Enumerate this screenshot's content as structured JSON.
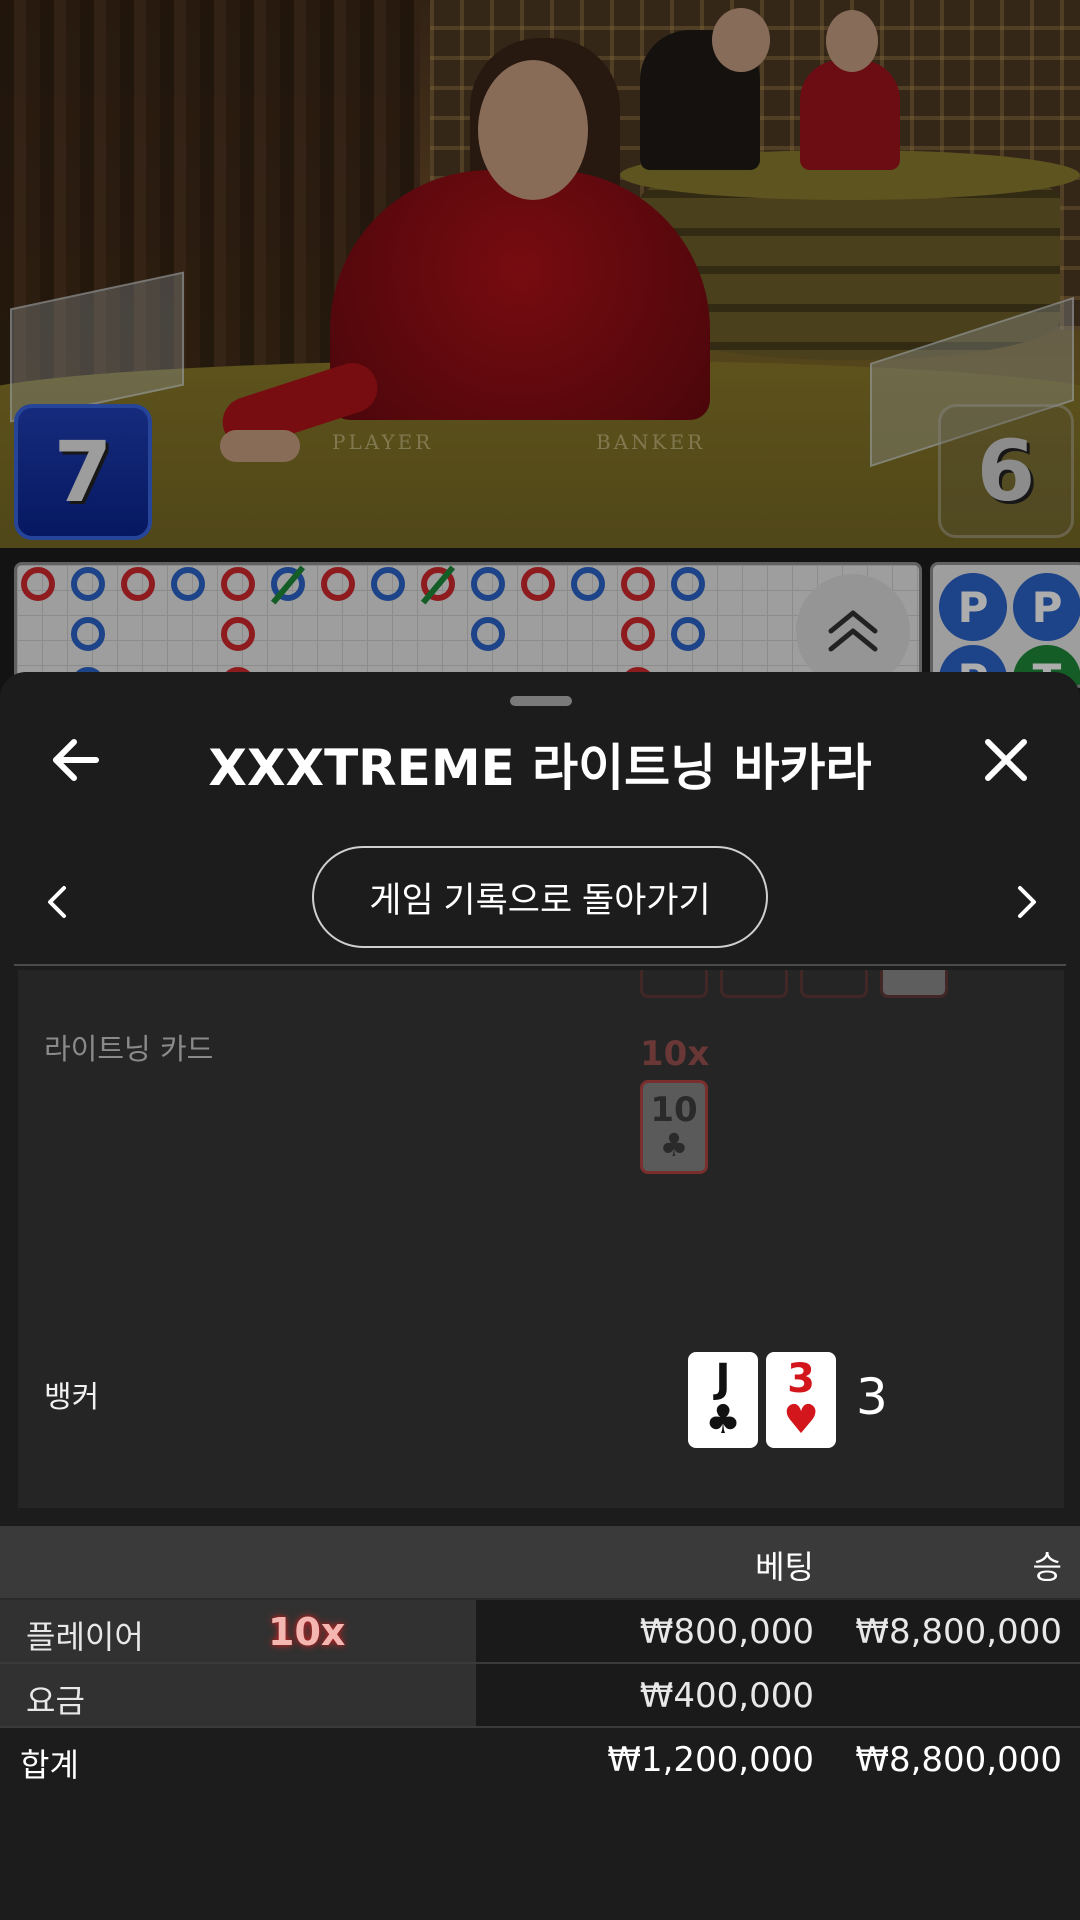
{
  "video": {
    "player_score": "7",
    "banker_score": "6",
    "felt_player": "PLAYER",
    "felt_banker": "BANKER"
  },
  "roadmap": {
    "bead_labels": [
      "P",
      "P",
      "P",
      "T"
    ]
  },
  "sheet": {
    "title": "XXXTREME 라이트닝 바카라",
    "back_to_history": "게임 기록으로 돌아가기",
    "lightning_label": "라이트닝 카드",
    "lightning_multiplier": "10x",
    "lightning_card": {
      "rank": "10",
      "suit": "♣"
    },
    "banker_label": "뱅커",
    "banker_cards": [
      {
        "rank": "J",
        "suit": "♣"
      },
      {
        "rank": "3",
        "suit": "♥"
      }
    ],
    "banker_total": "3"
  },
  "bets": {
    "col_bet": "베팅",
    "col_win": "승",
    "rows": [
      {
        "name": "플레이어",
        "multiplier": "10x",
        "bet": "₩800,000",
        "win": "₩8,800,000"
      },
      {
        "name": "요금",
        "bet": "₩400,000",
        "win": ""
      }
    ],
    "total": {
      "name": "합계",
      "bet": "₩1,200,000",
      "win": "₩8,800,000"
    }
  },
  "colors": {
    "player_blue": "#2c64c9",
    "banker_red": "#d12a2f",
    "tie_green": "#1e8a3a",
    "sheet_bg": "#1c1c1c"
  }
}
